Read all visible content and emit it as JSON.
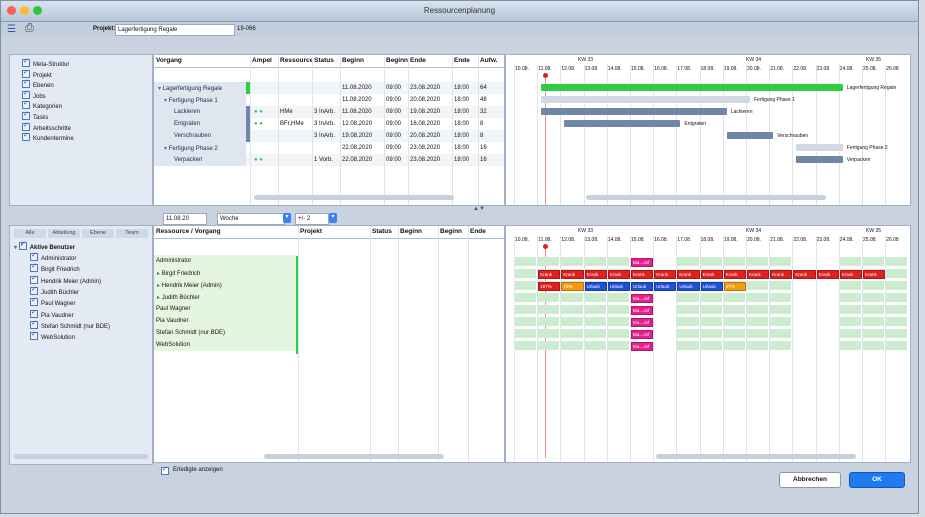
{
  "window": {
    "title": "Ressourcenplanung"
  },
  "toolbar": {
    "project_label": "Projekt:",
    "project_value": "Lagerfertigung Regale",
    "project_code": "19-066"
  },
  "top_tree": {
    "items": [
      "Meta-Struktur",
      "Projekt",
      "Ebenen",
      "Jobs",
      "Kategorien",
      "Tasks",
      "Arbeitsschritte",
      "Kundentermine"
    ]
  },
  "top_table": {
    "headers": {
      "vorgang": "Vorgang",
      "ampel": "Ampel",
      "ressource": "Ressource",
      "status": "Status",
      "beginn": "Beginn",
      "beginn2": "Beginn",
      "ende": "Ende",
      "ende2": "Ende",
      "aufw": "Aufw."
    },
    "rows": [
      {
        "name": "Lagerfertigung Regale",
        "ressource": "",
        "status": "",
        "beginn": "11.08.2020",
        "bzeit": "09:00",
        "ende": "23.08.2020",
        "ezeit": "18:00",
        "aufw": "64"
      },
      {
        "name": "Fertigung Phase 1",
        "ressource": "",
        "status": "",
        "beginn": "11.08.2020",
        "bzeit": "09:00",
        "ende": "20.08.2020",
        "ezeit": "18:00",
        "aufw": "48"
      },
      {
        "name": "Lackieren",
        "ressource": "HMe",
        "status": "3 InArb.",
        "beginn": "11.08.2020",
        "bzeit": "09:00",
        "ende": "19.08.2020",
        "ezeit": "18:00",
        "aufw": "32"
      },
      {
        "name": "Entgraten",
        "ressource": "BFr,HMe",
        "status": "3 InArb.",
        "beginn": "12.08.2020",
        "bzeit": "09:00",
        "ende": "16.08.2020",
        "ezeit": "18:00",
        "aufw": "8"
      },
      {
        "name": "Verschrauben",
        "ressource": "",
        "status": "3 InArb.",
        "beginn": "19.08.2020",
        "bzeit": "09:00",
        "ende": "20.08.2020",
        "ezeit": "18:00",
        "aufw": "8"
      },
      {
        "name": "Fertigung Phase 2",
        "ressource": "",
        "status": "",
        "beginn": "22.08.2020",
        "bzeit": "09:00",
        "ende": "23.08.2020",
        "ezeit": "18:00",
        "aufw": "16"
      },
      {
        "name": "Verpacken",
        "ressource": "",
        "status": "1 Vorb.",
        "beginn": "22.08.2020",
        "bzeit": "09:00",
        "ende": "23.08.2020",
        "ezeit": "18:00",
        "aufw": "16"
      }
    ]
  },
  "timeline": {
    "weeks": [
      "KW 33",
      "KW 34",
      "KW 35"
    ],
    "days": [
      "10.08.",
      "11.08.",
      "12.08.",
      "13.08.",
      "14.08.",
      "15.08.",
      "16.08.",
      "17.08.",
      "18.08.",
      "19.08.",
      "20.08.",
      "21.08.",
      "22.08.",
      "23.08.",
      "24.08.",
      "25.08.",
      "26.08"
    ],
    "gantt_labels": [
      "Lagerfertigung Regale",
      "Fertigung Phase 1",
      "Lackieren",
      "Entgraten",
      "Verschrauben",
      "Fertigung Phase 2",
      "Verpacken"
    ]
  },
  "bottom_controls": {
    "date": "11.08.20",
    "range": "Woche",
    "delta": "+/- 2"
  },
  "bottom_tree": {
    "tabs": [
      "Alle",
      "Abteilung",
      "Ebene",
      "Team"
    ],
    "group": "Aktive Benutzer",
    "items": [
      "Administrator",
      "Birgit Friedrich",
      "Hendrik Meier (Admin)",
      "Judith Büchler",
      "Paul Wagner",
      "Pia Vaudner",
      "Stefan Schmidt (nur BDE)",
      "WebSolution"
    ]
  },
  "bottom_table": {
    "headers": {
      "ressource": "Ressource / Vorgang",
      "projekt": "Projekt",
      "status": "Status",
      "beginn": "Beginn",
      "beginn2": "Beginn",
      "ende": "Ende"
    },
    "rows": [
      "Administrator",
      "Birgit Friedrich",
      "Hendrik Meier (Admin)",
      "Judith Büchler",
      "Paul Wagner",
      "Pia Vaudner",
      "Stefan Schmidt (nur BDE)",
      "WebSolution"
    ]
  },
  "bottom_labels": {
    "krank": "Krank",
    "urlaub": "Urlaub",
    "ma": "Ma....Inf",
    "pct1": "187%",
    "pct2": "79%",
    "pct3": "47%"
  },
  "footer": {
    "show_done": "Erledigte anzeigen",
    "cancel": "Abbrechen",
    "ok": "OK"
  },
  "colors": {
    "green": "#2ecc40",
    "blue": "#1f4fd8",
    "red": "#e02020",
    "pink": "#e6218f",
    "orange": "#f39c12",
    "slate": "#6f86a8"
  }
}
